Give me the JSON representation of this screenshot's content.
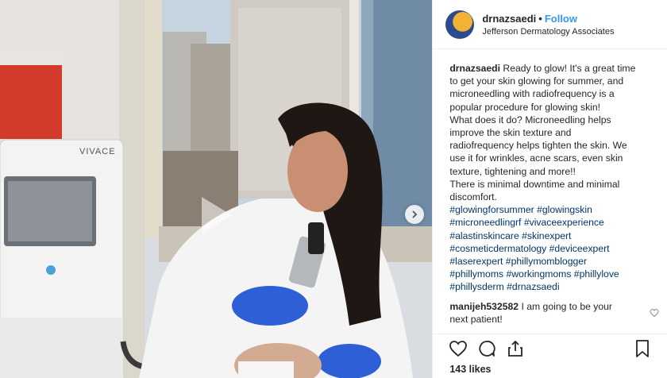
{
  "post": {
    "username": "drnazsaedi",
    "separator": "•",
    "follow_label": "Follow",
    "location": "Jefferson Dermatology Associates",
    "machine_brand": "VIVACE",
    "caption_user": "drnazsaedi",
    "caption_lines": [
      "Ready to glow! It's a great time",
      "to get your skin glowing for summer, and",
      "microneedling with radiofrequency is a",
      "popular procedure for glowing skin!",
      "What does it do? Microneedling helps",
      "improve the skin texture and",
      "radiofrequency helps tighten the skin. We",
      "use it for wrinkles, acne scars, even skin",
      "texture, tightening and more!!",
      "There is minimal downtime and minimal",
      "discomfort."
    ],
    "hashtag_lines": [
      "#glowingforsummer #glowingskin",
      "#microneedlingrf #vivaceexperience",
      "#alastinskincare #skinexpert",
      "#cosmeticdermatology #deviceexpert",
      "#laserexpert #phillymomblogger",
      "#phillymoms #workingmoms #phillylove",
      "#phillysderm #drnazsaedi"
    ],
    "comment": {
      "user": "manijeh532582",
      "text_line1": "I am going to be your",
      "text_line2": "next patient!"
    },
    "likes": "143 likes"
  },
  "icons": {
    "like": "heart-icon",
    "comment": "comment-icon",
    "share": "share-icon",
    "save": "bookmark-icon",
    "next": "chevron-right-icon",
    "play": "play-icon"
  },
  "colors": {
    "link_blue": "#3897f0",
    "hashtag": "#003569",
    "text": "#262626"
  }
}
